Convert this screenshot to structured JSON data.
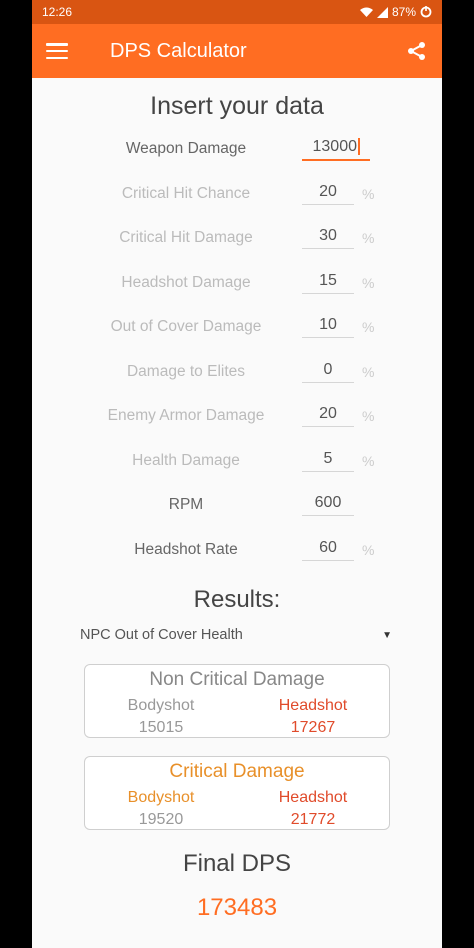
{
  "status": {
    "time": "12:26",
    "battery": "87%"
  },
  "appbar": {
    "title": "DPS Calculator"
  },
  "form": {
    "title": "Insert your data",
    "rows": [
      {
        "label": "Weapon Damage",
        "value": "13000",
        "unit": ""
      },
      {
        "label": "Critical Hit Chance",
        "value": "20",
        "unit": "%"
      },
      {
        "label": "Critical Hit Damage",
        "value": "30",
        "unit": "%"
      },
      {
        "label": "Headshot Damage",
        "value": "15",
        "unit": "%"
      },
      {
        "label": "Out of Cover Damage",
        "value": "10",
        "unit": "%"
      },
      {
        "label": "Damage to Elites",
        "value": "0",
        "unit": "%"
      },
      {
        "label": "Enemy Armor Damage",
        "value": "20",
        "unit": "%"
      },
      {
        "label": "Health Damage",
        "value": "5",
        "unit": "%"
      },
      {
        "label": "RPM",
        "value": "600",
        "unit": ""
      },
      {
        "label": "Headshot Rate",
        "value": "60",
        "unit": "%"
      }
    ]
  },
  "results": {
    "title": "Results:",
    "dropdown_selected": "NPC Out of Cover Health",
    "non_critical": {
      "title": "Non Critical Damage",
      "bodyshot_label": "Bodyshot",
      "headshot_label": "Headshot",
      "bodyshot_value": "15015",
      "headshot_value": "17267"
    },
    "critical": {
      "title": "Critical Damage",
      "bodyshot_label": "Bodyshot",
      "headshot_label": "Headshot",
      "bodyshot_value": "19520",
      "headshot_value": "21772"
    },
    "final_title": "Final DPS",
    "final_value": "173483"
  },
  "colors": {
    "accent": "#ff6d22",
    "status_bar": "#d95512",
    "headshot_red": "#e04b2b",
    "critical_orange": "#e8902a"
  }
}
